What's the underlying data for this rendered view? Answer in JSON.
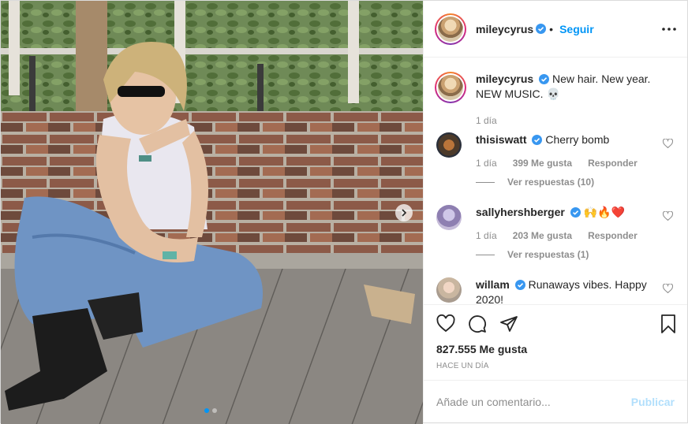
{
  "header": {
    "username": "mileycyrus",
    "follow_label": "Seguir",
    "more_icon": "more-dots-icon"
  },
  "caption": {
    "username": "mileycyrus",
    "text": "New hair. New year. NEW MUSIC. 💀",
    "time": "1 día"
  },
  "comments": [
    {
      "username": "thisiswatt",
      "text": "Cherry bomb",
      "time": "1 día",
      "likes": "399 Me gusta",
      "reply": "Responder",
      "view_replies": "Ver respuestas (10)"
    },
    {
      "username": "sallyhershberger",
      "text": "🙌🔥❤️",
      "time": "1 día",
      "likes": "203 Me gusta",
      "reply": "Responder",
      "view_replies": "Ver respuestas (1)"
    },
    {
      "username": "willam",
      "text": "Runaways vibes. Happy 2020!"
    }
  ],
  "actions": {
    "likes": "827.555 Me gusta",
    "timestamp": "HACE UN DÍA"
  },
  "comment_box": {
    "placeholder": "Añade un comentario...",
    "publish_label": "Publicar"
  },
  "carousel": {
    "total": 2,
    "active": 1
  },
  "colors": {
    "link_blue": "#0095f6",
    "publish_disabled": "#b2dffc",
    "verified_blue": "#3897f0"
  }
}
